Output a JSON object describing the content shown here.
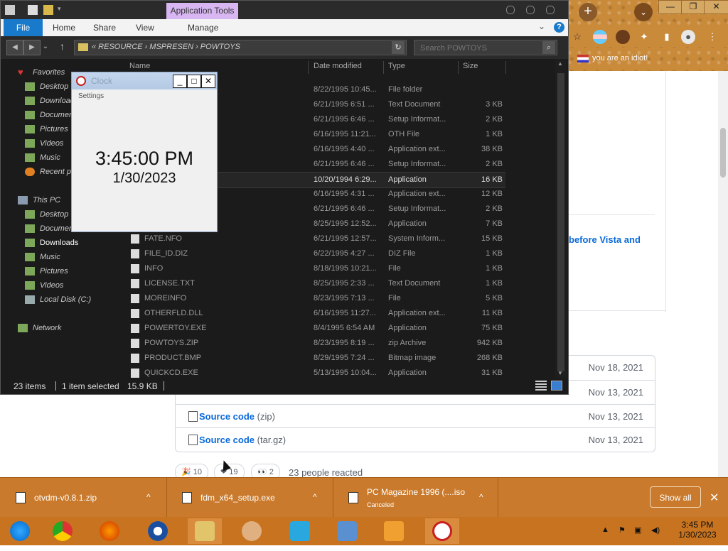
{
  "browser": {
    "bookmark": "you are an idiot!",
    "section_heading": "before Vista and",
    "assets": [
      {
        "name": "",
        "ext": "",
        "date": "Nov 18, 2021"
      },
      {
        "name": "",
        "ext": "",
        "date": "Nov 13, 2021"
      },
      {
        "name": "Source code",
        "ext": "(zip)",
        "date": "Nov 13, 2021"
      },
      {
        "name": "Source code",
        "ext": "(tar.gz)",
        "date": "Nov 13, 2021"
      }
    ],
    "reactions": {
      "tada": "10",
      "heart": "19",
      "eyes": "2",
      "summary": "23 people reacted"
    }
  },
  "explorer": {
    "contextual_tab": "Application Tools",
    "ribbon_tabs": [
      "File",
      "Home",
      "Share",
      "View",
      "Manage"
    ],
    "address_crumbs": "« RESOURCE  ›  MSPRESEN  ›  POWTOYS",
    "search_placeholder": "Search POWTOYS",
    "nav": {
      "favorites": "Favorites",
      "favorites_items": [
        "Desktop",
        "Downloads",
        "Documents",
        "Pictures",
        "Videos",
        "Music",
        "Recent places"
      ],
      "this_pc": "This PC",
      "pc_items": [
        "Desktop",
        "Documents",
        "Downloads",
        "Music",
        "Pictures",
        "Videos",
        "Local Disk (C:)"
      ],
      "network": "Network"
    },
    "columns": {
      "name": "Name",
      "date": "Date modified",
      "type": "Type",
      "size": "Size"
    },
    "files": [
      {
        "name": "",
        "date": "8/22/1995 10:45...",
        "type": "File folder",
        "size": ""
      },
      {
        "name": "",
        "date": "6/21/1995 6:51 ...",
        "type": "Text Document",
        "size": "3 KB"
      },
      {
        "name": "",
        "date": "6/21/1995 6:46 ...",
        "type": "Setup Informat...",
        "size": "2 KB"
      },
      {
        "name": "",
        "date": "6/16/1995 11:21...",
        "type": "OTH File",
        "size": "1 KB"
      },
      {
        "name": "",
        "date": "6/16/1995 4:40 ...",
        "type": "Application ext...",
        "size": "38 KB"
      },
      {
        "name": "",
        "date": "6/21/1995 6:46 ...",
        "type": "Setup Informat...",
        "size": "2 KB"
      },
      {
        "name": "",
        "date": "10/20/1994 6:29...",
        "type": "Application",
        "size": "16 KB",
        "selected": true
      },
      {
        "name": "",
        "date": "6/16/1995 4:31 ...",
        "type": "Application ext...",
        "size": "12 KB"
      },
      {
        "name": "",
        "date": "6/21/1995 6:46 ...",
        "type": "Setup Informat...",
        "size": "2 KB"
      },
      {
        "name": "",
        "date": "8/25/1995 12:52...",
        "type": "Application",
        "size": "7 KB"
      },
      {
        "name": "FATE.NFO",
        "date": "6/21/1995 12:57...",
        "type": "System Inform...",
        "size": "15 KB"
      },
      {
        "name": "FILE_ID.DIZ",
        "date": "6/22/1995 4:27 ...",
        "type": "DIZ File",
        "size": "1 KB"
      },
      {
        "name": "INFO",
        "date": "8/18/1995 10:21...",
        "type": "File",
        "size": "1 KB"
      },
      {
        "name": "LICENSE.TXT",
        "date": "8/25/1995 2:33 ...",
        "type": "Text Document",
        "size": "1 KB"
      },
      {
        "name": "MOREINFO",
        "date": "8/23/1995 7:13 ...",
        "type": "File",
        "size": "5 KB"
      },
      {
        "name": "OTHERFLD.DLL",
        "date": "6/16/1995 11:27...",
        "type": "Application ext...",
        "size": "11 KB"
      },
      {
        "name": "POWERTOY.EXE",
        "date": "8/4/1995 6:54 AM",
        "type": "Application",
        "size": "75 KB"
      },
      {
        "name": "POWTOYS.ZIP",
        "date": "8/23/1995 8:19 ...",
        "type": "zip Archive",
        "size": "942 KB"
      },
      {
        "name": "PRODUCT.BMP",
        "date": "8/29/1995 7:24 ...",
        "type": "Bitmap image",
        "size": "268 KB"
      },
      {
        "name": "QUICKCD.EXE",
        "date": "5/13/1995 10:04...",
        "type": "Application",
        "size": "31 KB"
      }
    ],
    "status": {
      "items": "23 items",
      "selected": "1 item selected",
      "size": "15.9 KB"
    }
  },
  "clock": {
    "title": "Clock",
    "menu": "Settings",
    "time": "3:45:00 PM",
    "date": "1/30/2023"
  },
  "downloads": {
    "items": [
      {
        "name": "otvdm-v0.8.1.zip",
        "status": ""
      },
      {
        "name": "fdm_x64_setup.exe",
        "status": ""
      },
      {
        "name": "PC Magazine 1996 (....iso",
        "status": "Canceled"
      }
    ],
    "show_all": "Show all"
  },
  "taskbar": {
    "time": "3:45 PM",
    "date": "1/30/2023"
  }
}
